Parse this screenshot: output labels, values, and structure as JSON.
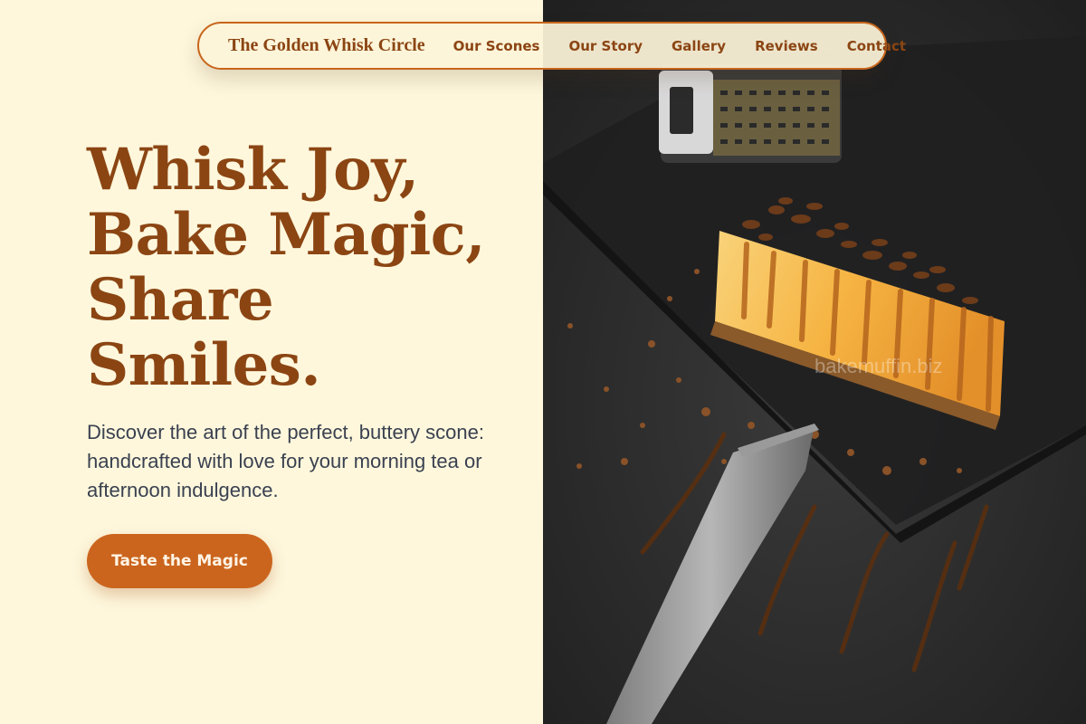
{
  "brand": {
    "name": "The Golden Whisk Circle"
  },
  "nav": {
    "items": [
      {
        "label": "Our Scones"
      },
      {
        "label": "Our Story"
      },
      {
        "label": "Gallery"
      },
      {
        "label": "Reviews"
      },
      {
        "label": "Contact"
      }
    ]
  },
  "hero": {
    "title_lines": [
      "Whisk Joy,",
      "Bake Magic,",
      "Share",
      "Smiles."
    ],
    "subtitle": "Discover the art of the perfect, buttery scone: handcrafted with love for your morning tea or afternoon indulgence.",
    "cta_label": "Taste the Magic"
  },
  "photo": {
    "watermark": "bakemuffin.biz"
  },
  "colors": {
    "background": "#FEF7DC",
    "primary_brown": "#8B4513",
    "accent_orange": "#CB651E",
    "body_text": "#3A4150"
  }
}
